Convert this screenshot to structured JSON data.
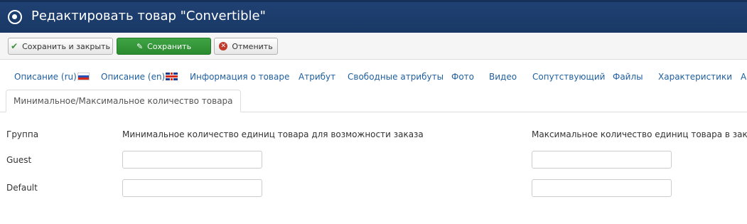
{
  "header": {
    "title": "Редактировать товар \"Convertible\""
  },
  "toolbar": {
    "save_close_label": "Сохранить и закрыть",
    "save_label": "Сохранить",
    "cancel_label": "Отменить"
  },
  "tabs": [
    {
      "label": "Описание (ru)",
      "flag": "ru"
    },
    {
      "label": "Описание (en)",
      "flag": "en"
    },
    {
      "label": "Информация о товаре"
    },
    {
      "label": "Атрибут"
    },
    {
      "label": "Свободные атрибуты"
    },
    {
      "label": "Фото"
    },
    {
      "label": "Видео"
    },
    {
      "label": "Сопутствующий"
    },
    {
      "label": "Файлы"
    },
    {
      "label": "Характеристики"
    },
    {
      "label": "А"
    }
  ],
  "active_tab": {
    "label": "Минимальное/Максимальное количество товара"
  },
  "table": {
    "col_group": "Группа",
    "col_min": "Минимальное количество единиц товара для возможности заказа",
    "col_max": "Максимальное количество единиц товара в заказе",
    "rows": [
      {
        "group": "Guest",
        "min": "",
        "max": ""
      },
      {
        "group": "Default",
        "min": "",
        "max": ""
      }
    ]
  }
}
